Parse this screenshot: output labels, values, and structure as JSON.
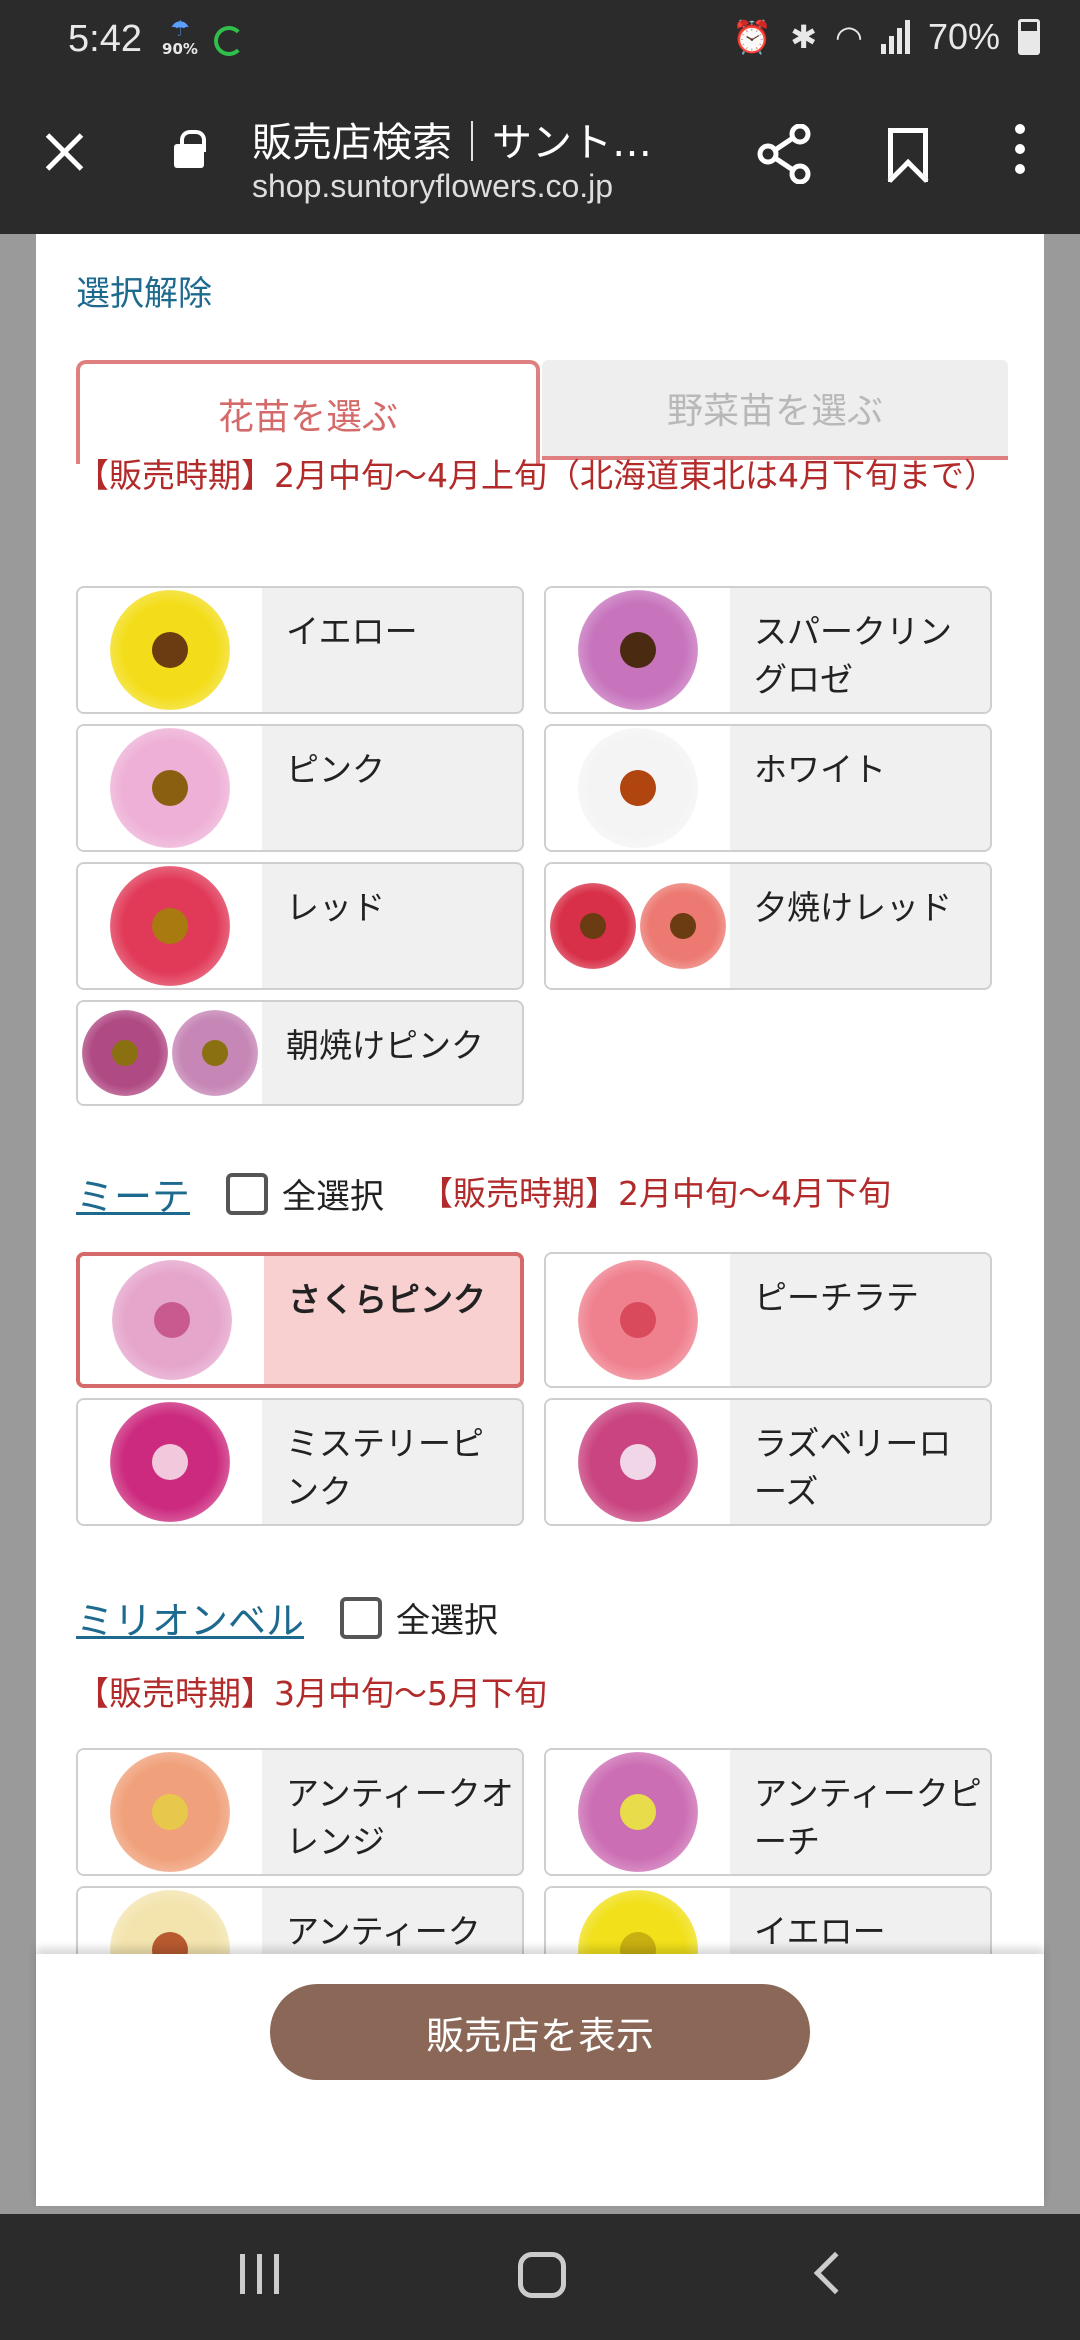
{
  "status_bar": {
    "time": "5:42",
    "weather_pct": "90%",
    "battery": "70%"
  },
  "browser": {
    "title": "販売店検索｜サント…",
    "domain": "shop.suntoryflowers.co.jp"
  },
  "filter": {
    "deselect_label": "選択解除",
    "tabs": [
      {
        "label": "花苗を選ぶ",
        "active": true
      },
      {
        "label": "野菜苗を選ぶ",
        "active": false
      }
    ],
    "first_period": "【販売時期】2月中旬〜4月上旬（北海道東北は4月下旬まで）",
    "first_group": [
      {
        "name": "イエロー",
        "colors": [
          "#f3dd1a"
        ],
        "center": "#6b3b12"
      },
      {
        "name": "スパークリングロゼ",
        "colors": [
          "#c774bd"
        ],
        "center": "#4a2a10"
      },
      {
        "name": "ピンク",
        "colors": [
          "#eeb0d6"
        ],
        "center": "#8a6010"
      },
      {
        "name": "ホワイト",
        "colors": [
          "#f4f4f4"
        ],
        "center": "#b04510"
      },
      {
        "name": "レッド",
        "colors": [
          "#e13a58"
        ],
        "center": "#a87a10"
      },
      {
        "name": "夕焼けレッド",
        "colors": [
          "#d83048",
          "#ec7a72"
        ],
        "center": "#6b3b12"
      },
      {
        "name": "朝焼けピンク",
        "colors": [
          "#b04a84",
          "#c686b6"
        ],
        "center": "#8a7010"
      }
    ],
    "miite": {
      "link": "ミーテ",
      "select_all": "全選択",
      "period": "【販売時期】2月中旬〜4月下旬",
      "items": [
        {
          "name": "さくらピンク",
          "colors": [
            "#e6a6cc"
          ],
          "center": "#c95a8f",
          "selected": true
        },
        {
          "name": "ピーチラテ",
          "colors": [
            "#ef808e"
          ],
          "center": "#d84a5c",
          "selected": false
        },
        {
          "name": "ミステリーピンク",
          "colors": [
            "#cc2a7e"
          ],
          "center": "#f2c8dc",
          "selected": false
        },
        {
          "name": "ラズベリーローズ",
          "colors": [
            "#c94480"
          ],
          "center": "#f0d6e6",
          "selected": false
        }
      ]
    },
    "million_bells": {
      "link": "ミリオンベル",
      "select_all": "全選択",
      "period": "【販売時期】3月中旬〜5月下旬",
      "items": [
        {
          "name": "アンティークオレンジ",
          "colors": [
            "#f0a07a"
          ],
          "center": "#e8c84a"
        },
        {
          "name": "アンティークピーチ",
          "colors": [
            "#cc6eb4"
          ],
          "center": "#e8dc4a"
        },
        {
          "name": "アンティーク",
          "colors": [
            "#f3e4ae"
          ],
          "center": "#b85a30"
        },
        {
          "name": "イエロー",
          "colors": [
            "#f1e01a"
          ],
          "center": "#c8b010"
        }
      ]
    },
    "show_button": "販売店を表示"
  }
}
